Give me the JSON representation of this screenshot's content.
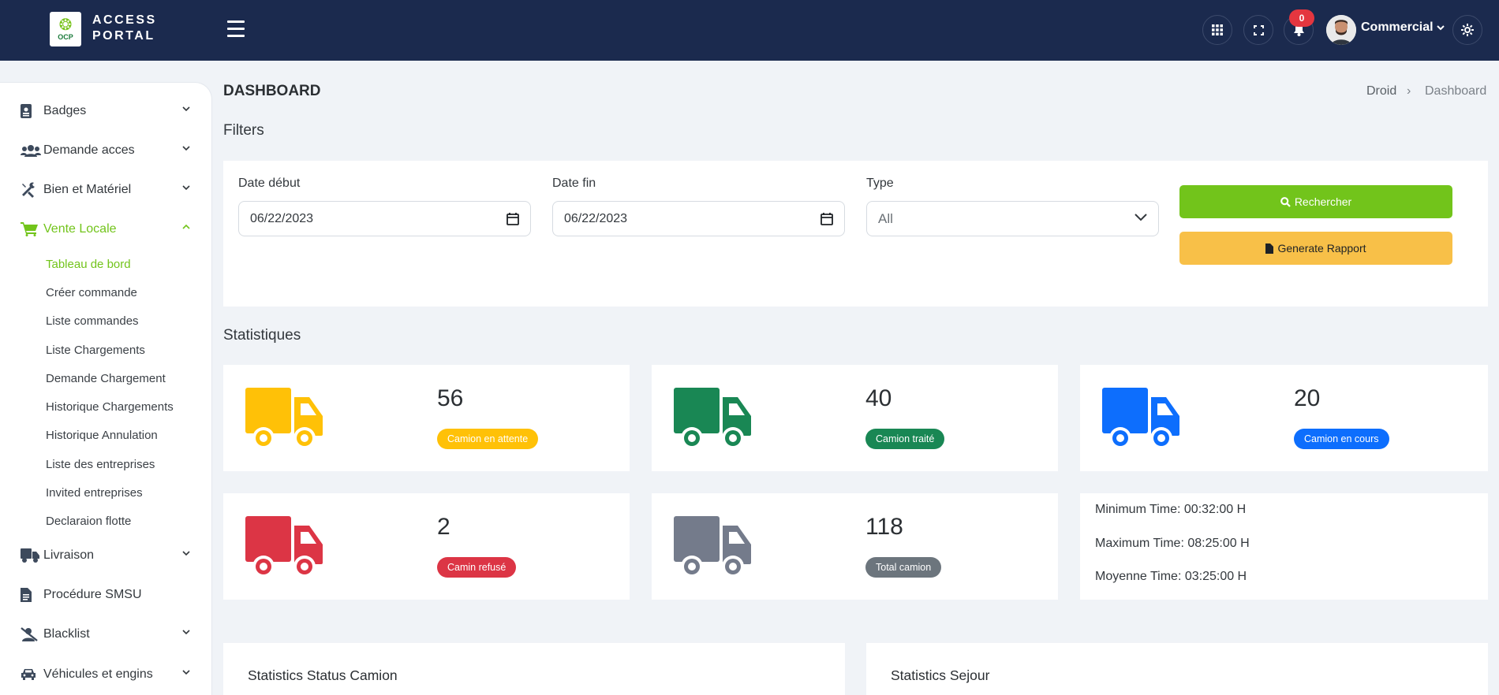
{
  "header": {
    "logo_text": "OCP",
    "brand_line1": "ACCESS",
    "brand_line2": "PORTAL",
    "notification_count": "0",
    "user_name": "Commercial"
  },
  "sidebar": {
    "items": [
      {
        "label": "Badges",
        "icon": "id-badge-icon",
        "expanded": false
      },
      {
        "label": "Demande acces",
        "icon": "users-icon",
        "expanded": false
      },
      {
        "label": "Bien et Matériel",
        "icon": "tools-icon",
        "expanded": false
      },
      {
        "label": "Vente Locale",
        "icon": "cart-icon",
        "expanded": true,
        "active": true
      },
      {
        "label": "Livraison",
        "icon": "truck-icon",
        "expanded": false
      },
      {
        "label": "Procédure SMSU",
        "icon": "file-icon"
      },
      {
        "label": "Blacklist",
        "icon": "user-slash-icon",
        "expanded": false
      },
      {
        "label": "Véhicules et engins",
        "icon": "car-icon",
        "expanded": false
      }
    ],
    "subitems": [
      {
        "label": "Tableau de bord",
        "active": true
      },
      {
        "label": "Créer commande"
      },
      {
        "label": "Liste commandes"
      },
      {
        "label": "Liste Chargements"
      },
      {
        "label": "Demande Chargement"
      },
      {
        "label": "Historique Chargements"
      },
      {
        "label": "Historique Annulation"
      },
      {
        "label": "Liste des entreprises"
      },
      {
        "label": "Invited entreprises"
      },
      {
        "label": "Declaraion flotte"
      }
    ]
  },
  "page": {
    "title": "DASHBOARD",
    "breadcrumb": [
      "Droid",
      "Dashboard"
    ],
    "breadcrumb_sep": "›"
  },
  "filters": {
    "section_title": "Filters",
    "date_debut_label": "Date début",
    "date_debut_value": "06/22/2023",
    "date_fin_label": "Date fin",
    "date_fin_value": "06/22/2023",
    "type_label": "Type",
    "type_value": "All",
    "search_button": "Rechercher",
    "report_button": "Generate Rapport"
  },
  "stats": {
    "section_title": "Statistiques",
    "cards": [
      {
        "value": "56",
        "label": "Camion en attente",
        "color": "#ffc107"
      },
      {
        "value": "40",
        "label": "Camion traité",
        "color": "#198754"
      },
      {
        "value": "20",
        "label": "Camion en cours",
        "color": "#0d6efd"
      },
      {
        "value": "2",
        "label": "Camin refusé",
        "color": "#dc3545"
      },
      {
        "value": "118",
        "label": "Total camion",
        "color": "#6c757d"
      }
    ],
    "truck_colors": [
      "#ffc107",
      "#198754",
      "#0d6efd",
      "#dc3545",
      "#747b8b"
    ],
    "times": {
      "min": "Minimum Time: 00:32:00 H",
      "max": "Maximum Time: 08:25:00 H",
      "avg": "Moyenne Time: 03:25:00 H"
    }
  },
  "bottom": {
    "status_title": "Statistics Status Camion",
    "sejour_title": "Statistics Sejour"
  }
}
